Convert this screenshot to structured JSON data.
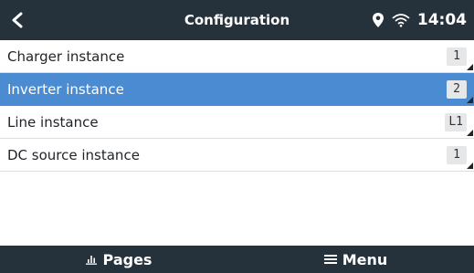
{
  "header": {
    "title": "Configuration",
    "time": "14:04",
    "icons": [
      "chevron-left-icon",
      "location-pin-icon",
      "wifi-icon"
    ]
  },
  "rows": [
    {
      "label": "Charger instance",
      "value": "1",
      "selected": false
    },
    {
      "label": "Inverter instance",
      "value": "2",
      "selected": true
    },
    {
      "label": "Line instance",
      "value": "L1",
      "selected": false
    },
    {
      "label": "DC source instance",
      "value": "1",
      "selected": false
    }
  ],
  "footer": {
    "pages_label": "Pages",
    "menu_label": "Menu",
    "icons": [
      "chart-icon",
      "hamburger-menu-icon"
    ]
  },
  "colors": {
    "bar_background": "#25323b",
    "selected_row": "#4a8bd1",
    "text": "#1f2328"
  }
}
